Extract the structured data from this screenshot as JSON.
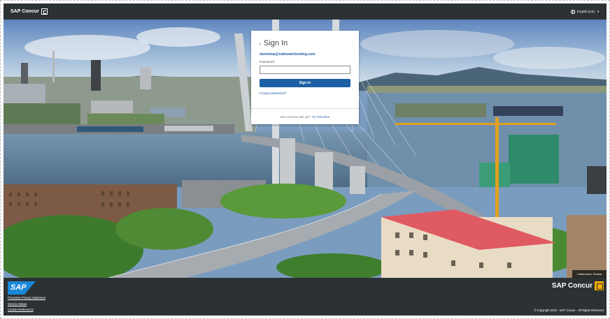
{
  "header": {
    "brand": "SAP Concur",
    "language": "English (US)"
  },
  "signin": {
    "title": "Sign In",
    "email": "domintop@nationalshooting.com",
    "password_label": "Password",
    "password_value": "",
    "button": "Sign In",
    "forgot": "Forgot password?",
    "footer_prefix": "Not a Concur user yet?",
    "footer_link": "Try Test Drive"
  },
  "hero": {
    "location": "Vladivostok, Russia"
  },
  "footer": {
    "sap_logo": "SAP",
    "links": [
      "Processor Privacy Statement",
      "Service Status",
      "Cookie Preferences"
    ],
    "brand": "SAP Concur",
    "copyright": "© Copyright 2020 - SAP Concur - All Rights Reserved"
  },
  "colors": {
    "bar": "#2c3134",
    "accent": "#1d5fa4",
    "concur_mark": "#f0ab00",
    "sap_logo": "#1a87d8"
  },
  "icons": [
    "concur-brand-icon",
    "globe-icon",
    "chevron-down-icon",
    "chevron-left-icon",
    "concur-mark-icon"
  ]
}
